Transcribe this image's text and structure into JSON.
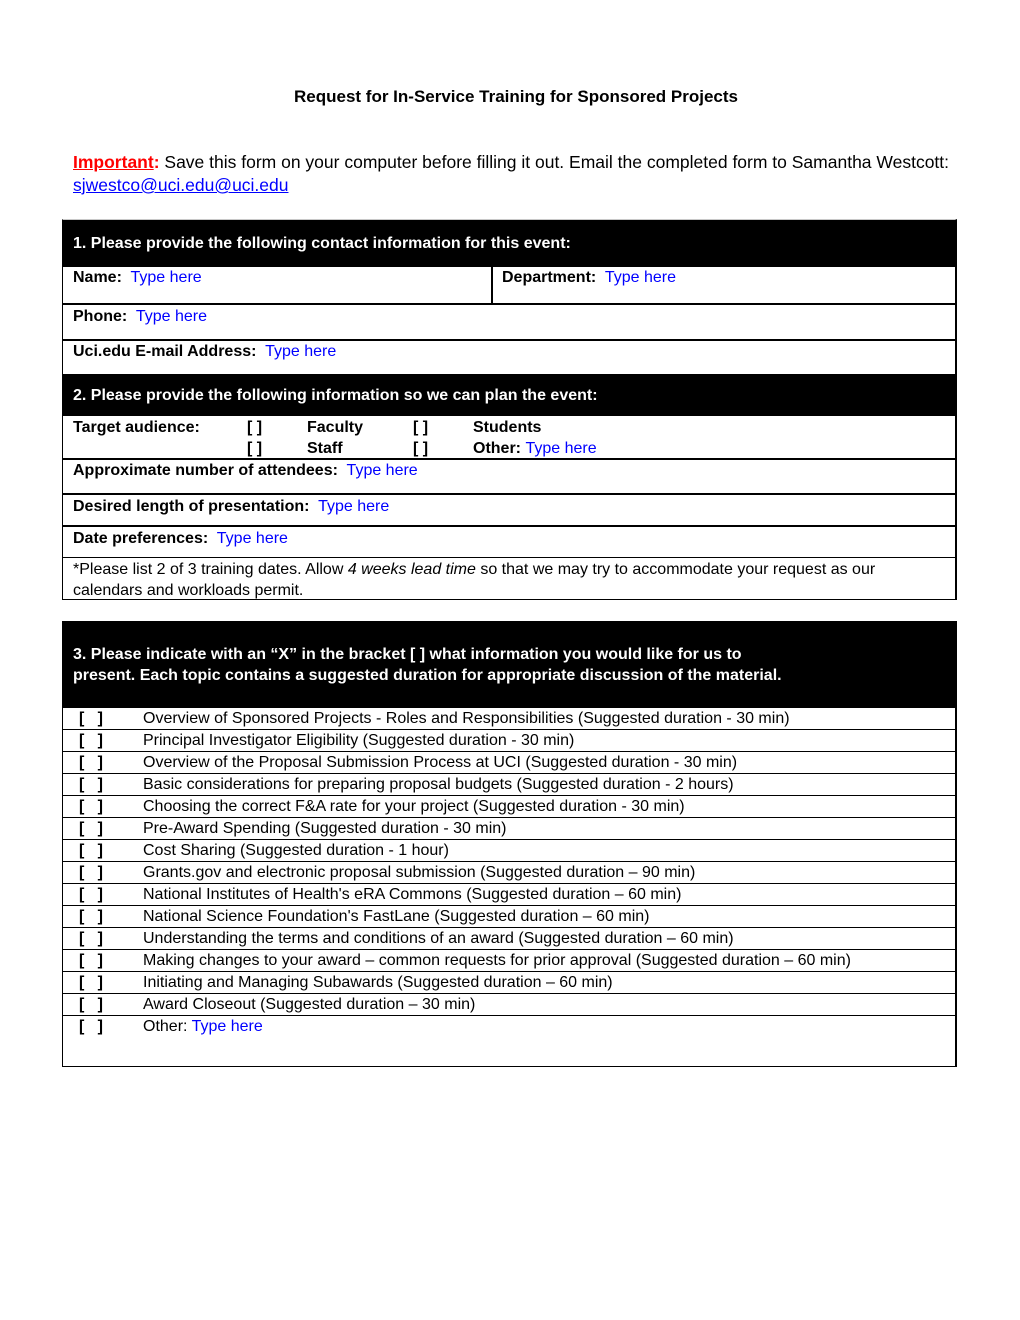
{
  "title": "Request for In-Service Training for Sponsored Projects",
  "notice": {
    "important_label": "Important",
    "colon": ":",
    "text": " Save this form on your computer before filling it out.  Email the completed form to Samantha Westcott:  ",
    "email_link": "sjwestco@uci.edu@uci.edu"
  },
  "colors": {
    "important": "#ff0000",
    "placeholder": "#0000ff",
    "header_bg": "#000000",
    "header_text": "#ffffff"
  },
  "section1": {
    "header": "1. Please provide the following contact information for this event:",
    "name_label": "Name:",
    "name_value": "Type here",
    "department_label": "Department:",
    "department_value": "Type here",
    "phone_label": "Phone:",
    "phone_value": "Type here",
    "email_label": "Uci.edu E-mail Address:",
    "email_value": "Type here"
  },
  "section2": {
    "header": "2. Please provide the following information so we can plan the event:",
    "target_label": "Target audience:",
    "bracket": "[   ]",
    "options": {
      "faculty": "Faculty",
      "students": "Students",
      "staff": "Staff",
      "other_label": "Other:",
      "other_value": "Type here"
    },
    "attendees_label": "Approximate number of attendees:",
    "attendees_value": "Type here",
    "length_label": "Desired length of presentation:",
    "length_value": "Type here",
    "dates_label": "Date preferences:",
    "dates_value": "Type here",
    "note_prefix": "*Please list 2 of 3 training dates. Allow ",
    "note_italic": "4 weeks lead time",
    "note_suffix": " so that we may try to accommodate your request as our calendars and workloads permit."
  },
  "section3": {
    "header_line1": "3. Please indicate with an “X” in the bracket [    ] what information you would like for us to",
    "header_line2": "present. Each topic contains a suggested duration for appropriate discussion of the material.",
    "bracket": "[   ]",
    "topics": [
      "Overview of Sponsored Projects - Roles and Responsibilities (Suggested duration - 30 min)",
      "Principal Investigator Eligibility (Suggested duration - 30 min)",
      "Overview of the Proposal Submission Process at UCI (Suggested duration - 30 min)",
      "Basic considerations for preparing proposal budgets (Suggested duration - 2 hours)",
      "Choosing the correct F&A rate for your project (Suggested duration - 30 min)",
      "Pre-Award Spending (Suggested duration - 30 min)",
      "Cost Sharing (Suggested duration - 1 hour)",
      "Grants.gov and electronic proposal submission (Suggested duration – 90 min)",
      "National Institutes of Health's eRA Commons (Suggested duration – 60 min)",
      "National Science Foundation's FastLane (Suggested duration – 60 min)",
      "Understanding the terms and conditions of an award (Suggested duration – 60 min)",
      "Making changes to your award – common requests for prior approval (Suggested duration – 60 min)",
      "Initiating and Managing Subawards (Suggested duration – 60 min)",
      "Award Closeout (Suggested duration – 30 min)"
    ],
    "other_label": "Other: ",
    "other_value": "Type here"
  }
}
